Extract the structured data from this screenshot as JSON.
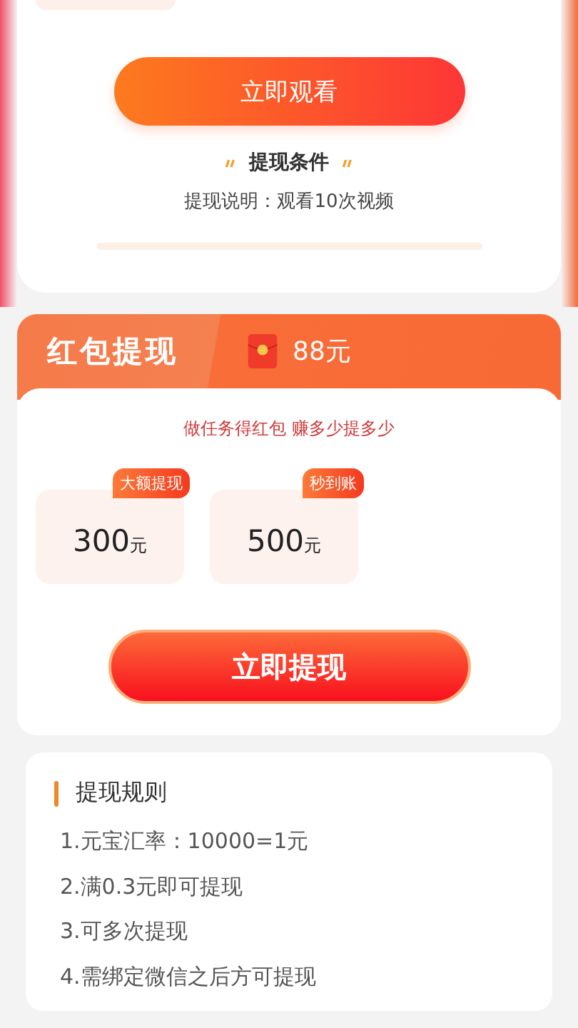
{
  "watch_section": {
    "watch_button": "立即观看",
    "condition_title": "提现条件",
    "condition_text": "提现说明：观看10次视频"
  },
  "withdraw_card": {
    "title": "红包提现",
    "balance": "88元",
    "slogan": "做任务得红包 赚多少提多少",
    "options": [
      {
        "badge": "大额提现",
        "amount": "300",
        "unit": "元"
      },
      {
        "badge": "秒到账",
        "amount": "500",
        "unit": "元"
      }
    ],
    "withdraw_button": "立即提现"
  },
  "rules": {
    "title": "提现规则",
    "items": [
      "1.元宝汇率：10000=1元",
      "2.满0.3元即可提现",
      "3.可多次提现",
      "4.需绑定微信之后方可提现"
    ]
  }
}
